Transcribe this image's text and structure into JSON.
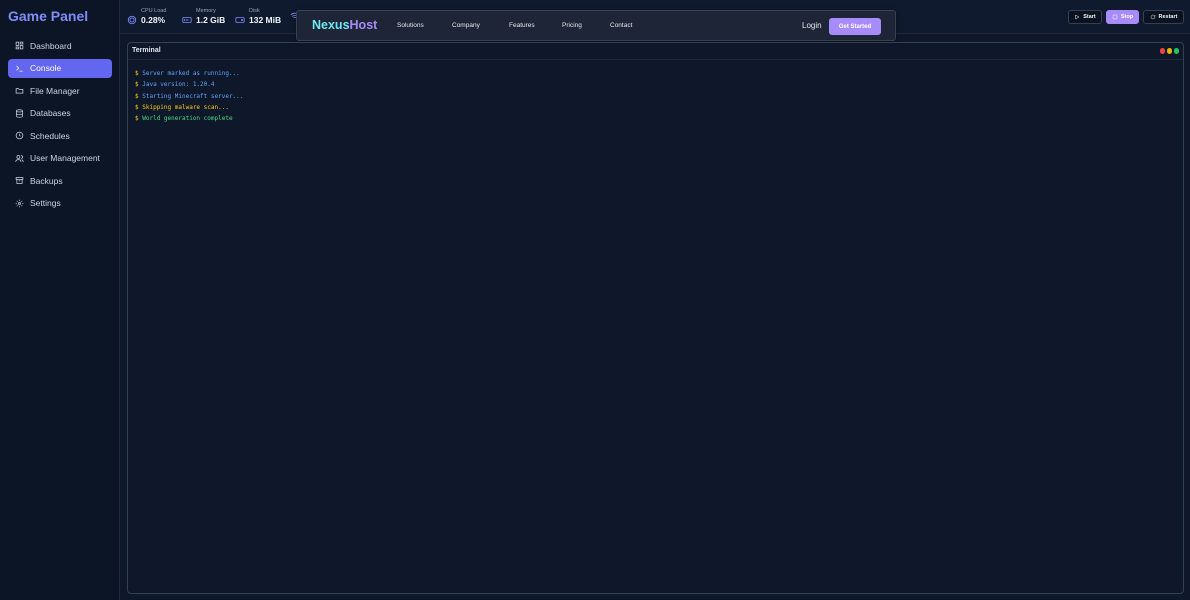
{
  "brand": "Game Panel",
  "sidebar": {
    "items": [
      {
        "label": "Dashboard",
        "icon": "dashboard-icon",
        "active": false
      },
      {
        "label": "Console",
        "icon": "terminal-icon",
        "active": true
      },
      {
        "label": "File Manager",
        "icon": "folder-icon",
        "active": false
      },
      {
        "label": "Databases",
        "icon": "database-icon",
        "active": false
      },
      {
        "label": "Schedules",
        "icon": "clock-icon",
        "active": false
      },
      {
        "label": "User Management",
        "icon": "users-icon",
        "active": false
      },
      {
        "label": "Backups",
        "icon": "archive-icon",
        "active": false
      },
      {
        "label": "Settings",
        "icon": "gear-icon",
        "active": false
      }
    ]
  },
  "stats": {
    "cpu": {
      "label": "CPU Load",
      "value": "0.28%"
    },
    "memory": {
      "label": "Memory",
      "value": "1.2 GiB"
    },
    "disk": {
      "label": "Disk",
      "value": "132 MiB"
    }
  },
  "controls": {
    "start": "Start",
    "stop": "Stop",
    "restart": "Restart"
  },
  "overlay": {
    "logo_first": "Nexus",
    "logo_second": "Host",
    "links": [
      "Solutions",
      "Company",
      "Features",
      "Pricing",
      "Contact"
    ],
    "login": "Login",
    "cta": "Get Started"
  },
  "terminal": {
    "title": "Terminal",
    "prompt": "$",
    "lines": [
      {
        "text": "Server marked as running...",
        "level": "info"
      },
      {
        "text": "Java version: 1.20.4",
        "level": "info"
      },
      {
        "text": "Starting Minecraft server...",
        "level": "info"
      },
      {
        "text": "Skipping malware scan...",
        "level": "warn"
      },
      {
        "text": "World generation complete",
        "level": "ok"
      }
    ]
  },
  "colors": {
    "accent": "#6366f1",
    "cta": "#a78bfa",
    "dot_red": "#ef4444",
    "dot_yellow": "#eab308",
    "dot_green": "#22c55e"
  }
}
